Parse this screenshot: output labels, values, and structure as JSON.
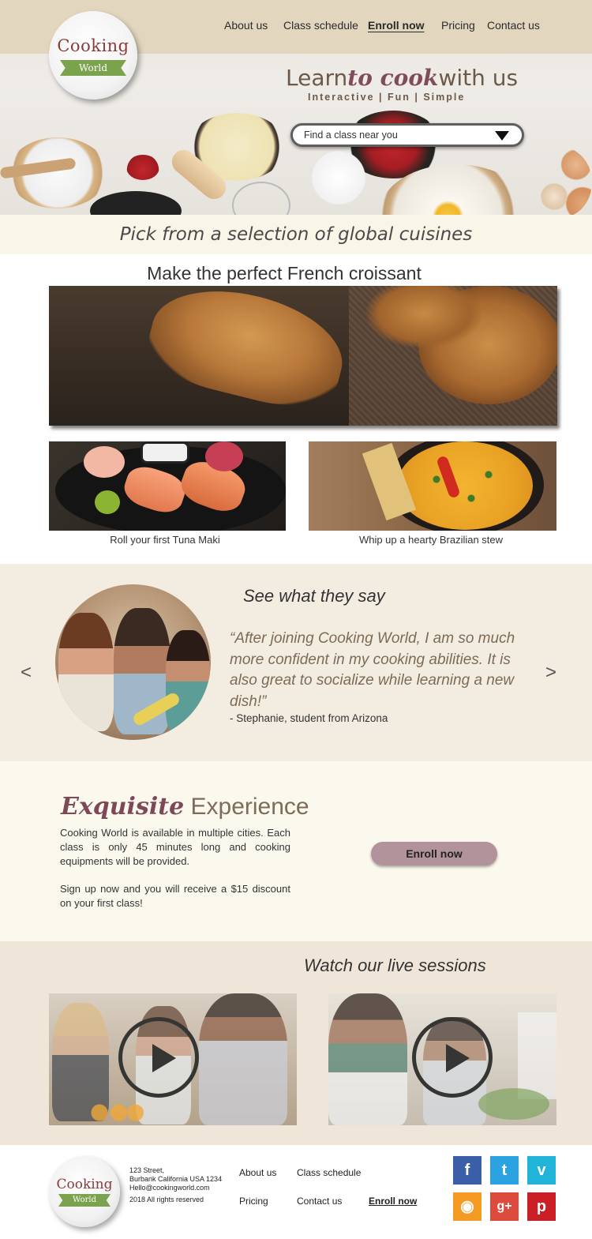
{
  "brand": {
    "logo_top": "Cooking",
    "logo_ribbon": "World"
  },
  "nav": {
    "items": [
      "About us",
      "Class schedule",
      "Enroll now",
      "Pricing",
      "Contact us"
    ],
    "active": "Enroll now"
  },
  "hero": {
    "tagline_pre": "Learn",
    "tagline_em": "to cook",
    "tagline_post": "with us",
    "subtag": "Interactive | Fun | Simple",
    "search_value": "Find a class near you"
  },
  "cuisines": {
    "banner": "Pick from a selection of global cuisines",
    "feature_title": "Make the perfect French croissant",
    "cards": [
      "Roll your first Tuna Maki",
      "Whip up a hearty Brazilian stew"
    ]
  },
  "testimonial": {
    "title": "See what they say",
    "quote": "“After joining Cooking World, I am so much more confident in my cooking abilities. It is also great to socialize while learning a new dish!”",
    "author": "- Stephanie, student from Arizona",
    "prev": "<",
    "next": ">"
  },
  "experience": {
    "heading_em": "Exquisite",
    "heading_rest": "Experience",
    "para1": "Cooking World is available in multiple cities. Each class is only 45 minutes long and cooking equipments will be provided.",
    "para2": "Sign up now and you will receive a $15 discount on your first class!",
    "button": "Enroll now"
  },
  "live": {
    "title": "Watch our live sessions"
  },
  "footer": {
    "address": [
      "123 Street,",
      "Burbank California USA 1234",
      "Hello@cookingworld.com",
      "2018 All rights reserved"
    ],
    "links": [
      "About us",
      "Class schedule",
      "Pricing",
      "Contact us",
      "Enroll now"
    ],
    "social": [
      {
        "icon": "facebook-icon",
        "glyph": "f",
        "color": "#3b5ea8"
      },
      {
        "icon": "twitter-icon",
        "glyph": "t",
        "color": "#2aa3e0"
      },
      {
        "icon": "vimeo-icon",
        "glyph": "v",
        "color": "#20b5d8"
      },
      {
        "icon": "rss-icon",
        "glyph": "◉",
        "color": "#f59a23"
      },
      {
        "icon": "google-plus-icon",
        "glyph": "g+",
        "color": "#dd4b3e"
      },
      {
        "icon": "pinterest-icon",
        "glyph": "p",
        "color": "#cb1f27"
      }
    ]
  },
  "colors": {
    "accent": "#7d4958",
    "band": "#f2ece1",
    "button": "#b3939b"
  }
}
